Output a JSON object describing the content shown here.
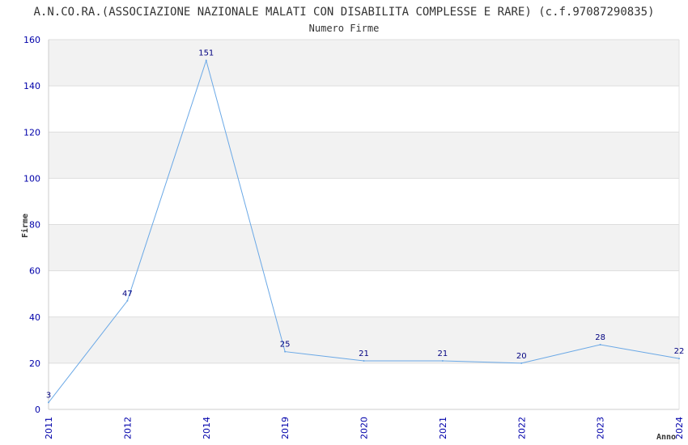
{
  "chart_data": {
    "type": "line",
    "title": "A.N.CO.RA.(ASSOCIAZIONE NAZIONALE MALATI CON DISABILITA COMPLESSE E RARE) (c.f.97087290835)",
    "subtitle": "Numero Firme",
    "xlabel": "Anno",
    "ylabel": "Firme",
    "categories": [
      "2011",
      "2012",
      "2014",
      "2019",
      "2020",
      "2021",
      "2022",
      "2023",
      "2024"
    ],
    "values": [
      3,
      47,
      151,
      25,
      21,
      21,
      20,
      28,
      22
    ],
    "ylim": [
      0,
      160
    ],
    "yticks": [
      0,
      20,
      40,
      60,
      80,
      100,
      120,
      140,
      160
    ],
    "grid": true,
    "colors": {
      "line": "#6aa8e6",
      "band": "#f2f2f2",
      "grid": "#dddddd",
      "tick_text": "#0000aa",
      "data_label": "#000080"
    }
  }
}
